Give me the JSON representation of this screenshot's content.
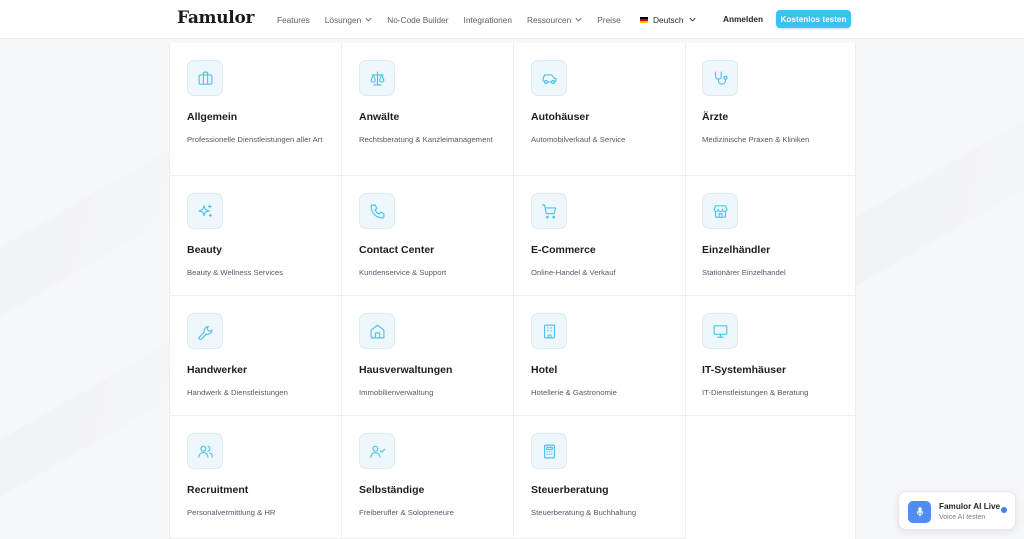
{
  "nav": {
    "logo": "Famulor",
    "links": [
      {
        "label": "Features",
        "dropdown": false
      },
      {
        "label": "Lösungen",
        "dropdown": true
      },
      {
        "label": "No-Code Builder",
        "dropdown": false
      },
      {
        "label": "Integrationen",
        "dropdown": false
      },
      {
        "label": "Ressourcen",
        "dropdown": true
      },
      {
        "label": "Preise",
        "dropdown": false
      }
    ],
    "language": "Deutsch",
    "login": "Anmelden",
    "cta": "Kostenlos testen"
  },
  "industries": [
    {
      "title": "Allgemein",
      "desc": "Professionelle Dienstleistungen aller Art",
      "icon": "briefcase-icon"
    },
    {
      "title": "Anwälte",
      "desc": "Rechtsberatung & Kanzleimanagement",
      "icon": "scale-icon"
    },
    {
      "title": "Autohäuser",
      "desc": "Automobilverkauf & Service",
      "icon": "car-icon"
    },
    {
      "title": "Ärzte",
      "desc": "Medizinische Praxen & Kliniken",
      "icon": "stethoscope-icon"
    },
    {
      "title": "Beauty",
      "desc": "Beauty & Wellness Services",
      "icon": "sparkles-icon"
    },
    {
      "title": "Contact Center",
      "desc": "Kundenservice & Support",
      "icon": "phone-icon"
    },
    {
      "title": "E-Commerce",
      "desc": "Online-Handel & Verkauf",
      "icon": "cart-icon"
    },
    {
      "title": "Einzelhändler",
      "desc": "Stationärer Einzelhandel",
      "icon": "store-icon"
    },
    {
      "title": "Handwerker",
      "desc": "Handwerk & Dienstleistungen",
      "icon": "wrench-icon"
    },
    {
      "title": "Hausverwaltungen",
      "desc": "Immobilienverwaltung",
      "icon": "home-icon"
    },
    {
      "title": "Hotel",
      "desc": "Hotellerie & Gastronomie",
      "icon": "building-icon"
    },
    {
      "title": "IT-Systemhäuser",
      "desc": "IT-Dienstleistungen & Beratung",
      "icon": "monitor-icon"
    },
    {
      "title": "Recruitment",
      "desc": "Personalvermittlung & HR",
      "icon": "users-icon"
    },
    {
      "title": "Selbständige",
      "desc": "Freiberufler & Solopreneure",
      "icon": "user-check-icon"
    },
    {
      "title": "Steuerberatung",
      "desc": "Steuerberatung & Buchhaltung",
      "icon": "calculator-icon"
    }
  ],
  "ai_widget": {
    "title": "Famulor AI Live",
    "subtitle": "Voice AI testen"
  },
  "colors": {
    "accent": "#3bc1f2",
    "icon_stroke": "#4cc3ea",
    "mic": "#4f8df1"
  }
}
